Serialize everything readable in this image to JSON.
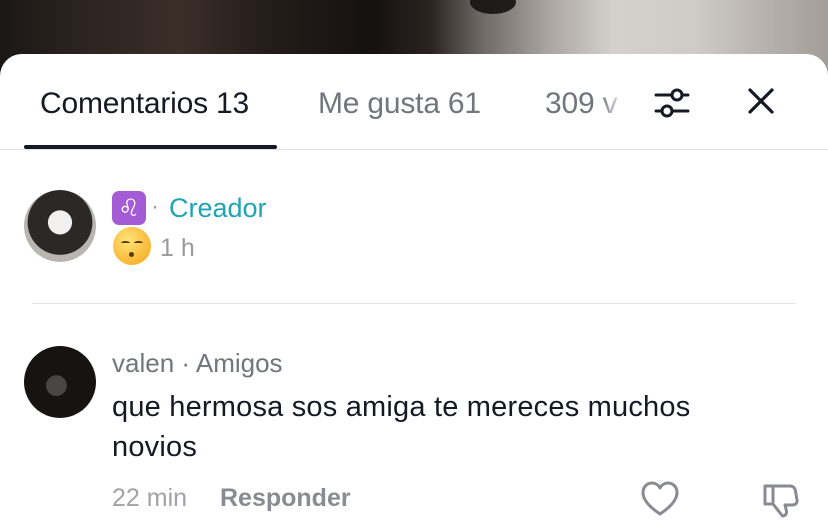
{
  "tabs": [
    {
      "label": "Comentarios 13",
      "active": true
    },
    {
      "label": "Me gusta 61",
      "active": false
    },
    {
      "label": "309 v",
      "active": false
    }
  ],
  "icons": {
    "filter": "sliders-icon",
    "close": "close-icon",
    "like": "heart-outline-icon",
    "dislike": "thumbs-down-icon"
  },
  "colors": {
    "creator_accent": "#20a3b4",
    "zodiac_badge": "#a35bd6",
    "text_primary": "#161823",
    "text_secondary": "#73757c"
  },
  "comments": [
    {
      "zodiac_emoji": "♌",
      "separator": "·",
      "role": "Creador",
      "emoji": "😮‍💨",
      "time": "1 h"
    },
    {
      "username": "valen",
      "separator": "·",
      "relation": "Amigos",
      "text": "que hermosa sos amiga te mereces muchos novios",
      "time": "22 min",
      "reply_label": "Responder"
    }
  ]
}
